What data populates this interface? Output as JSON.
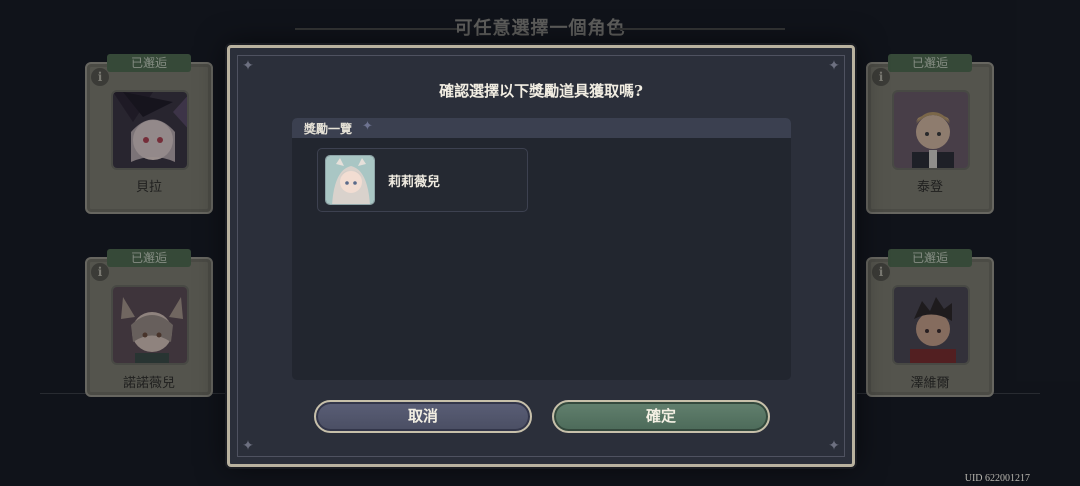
{
  "background": {
    "title": "可任意選擇一個角色",
    "cards": [
      {
        "badge": "已邂逅",
        "name": "貝拉"
      },
      {
        "badge": "已邂逅",
        "name": "諾諾薇兒"
      },
      {
        "badge": "已邂逅",
        "name": "泰登"
      },
      {
        "badge": "已邂逅",
        "name": "澤維爾"
      }
    ]
  },
  "dialog": {
    "title": "確認選擇以下獎勵道具獲取嗎?",
    "reward_list_label": "獎勵一覽",
    "reward_item_name": "莉莉薇兒",
    "cancel_label": "取消",
    "confirm_label": "確定"
  },
  "footer": {
    "uid": "UID 622001217"
  },
  "colors": {
    "modal_bg": "#2b2f3a",
    "frame_gold": "#b9b29f",
    "cancel_button": "#55596f",
    "confirm_button": "#587662"
  }
}
